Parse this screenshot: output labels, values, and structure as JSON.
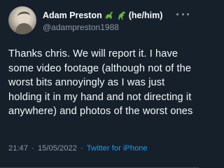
{
  "tweet": {
    "author": {
      "display_name": "Adam Preston",
      "emojis": [
        "sauropod-dinosaur-emoji",
        "t-rex-dinosaur-emoji"
      ],
      "pronouns": "(he/him)",
      "handle": "@adampreston1988"
    },
    "more_icon": "more-horizontal-icon",
    "text": "Thanks chris. We will report it. I have some video footage (although not of the worst bits annoyingly as I was just holding it in my hand and not directing it anywhere) and photos of the worst ones",
    "time": "21:47",
    "separator": "·",
    "date": "15/05/2022",
    "source": "Twitter for iPhone"
  },
  "colors": {
    "background": "#15202b",
    "text": "#f7f9f9",
    "secondary": "#8b98a5",
    "link": "#1d9bf0",
    "dino_green": "#67b346"
  }
}
